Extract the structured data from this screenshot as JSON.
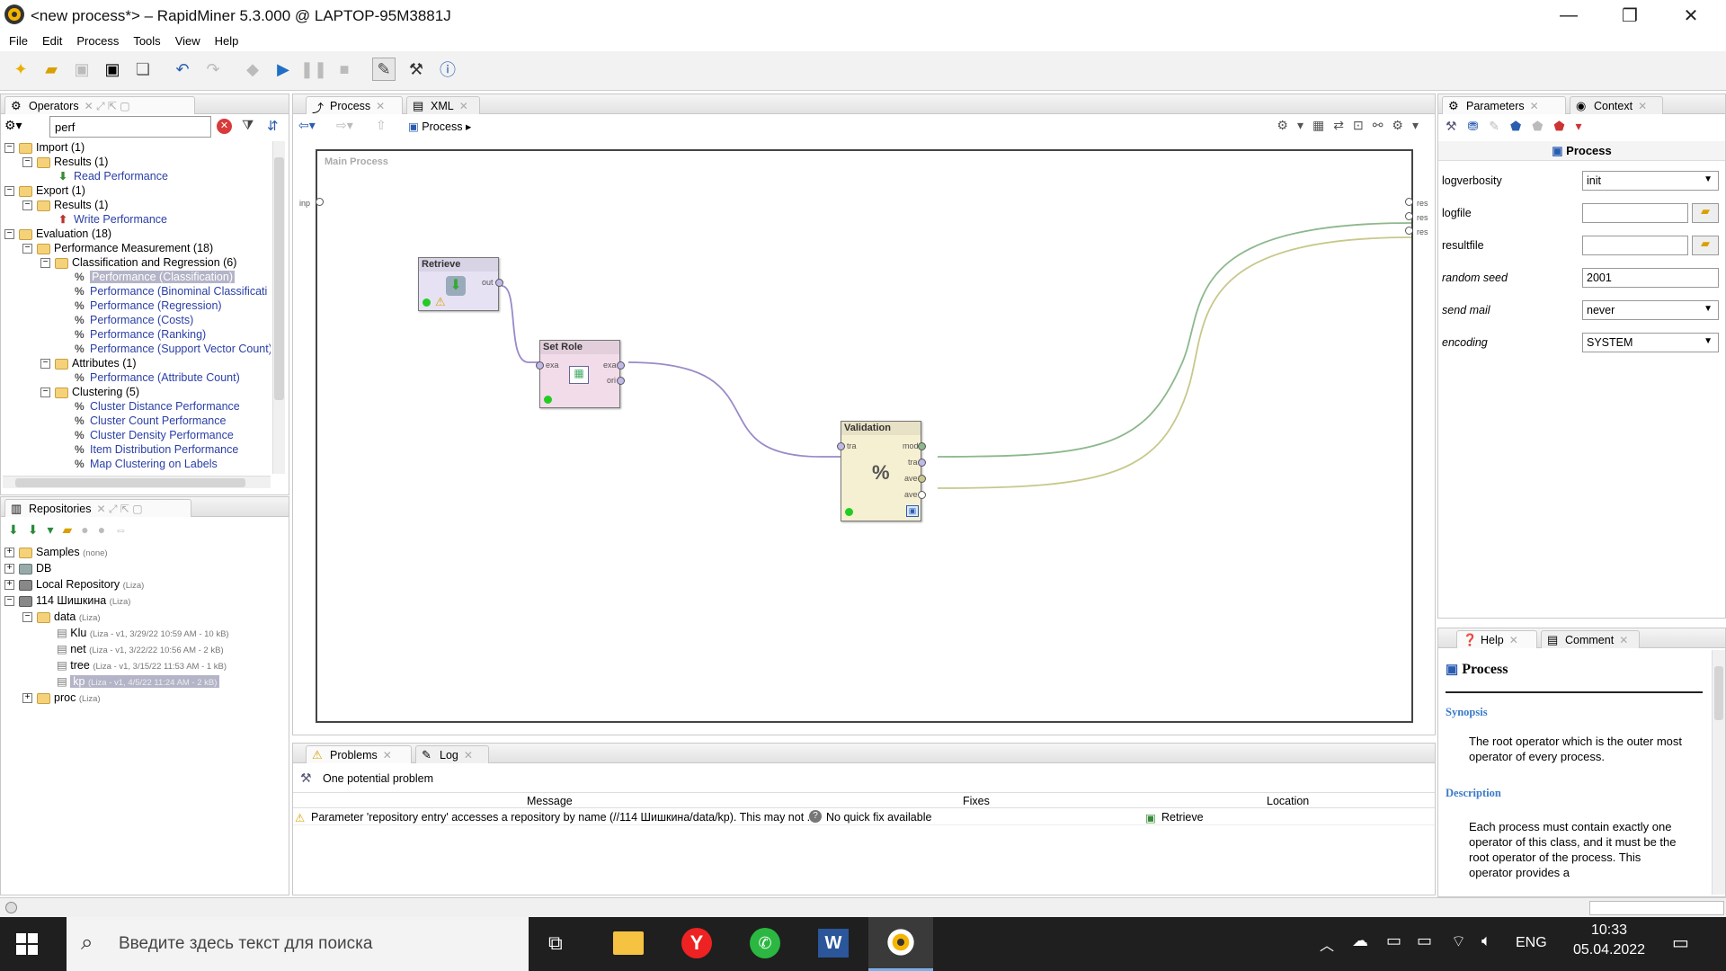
{
  "window": {
    "title": "<new process*> – RapidMiner 5.3.000 @ LAPTOP-95M3881J"
  },
  "menu": [
    "File",
    "Edit",
    "Process",
    "Tools",
    "View",
    "Help"
  ],
  "operators_panel": {
    "tab": "Operators",
    "search_value": "perf",
    "tree": [
      {
        "label": "Import (1)"
      },
      {
        "label": "Results (1)"
      },
      {
        "label": "Read Performance"
      },
      {
        "label": "Export (1)"
      },
      {
        "label": "Results (1)"
      },
      {
        "label": "Write Performance"
      },
      {
        "label": "Evaluation (18)"
      },
      {
        "label": "Performance Measurement (18)"
      },
      {
        "label": "Classification and Regression (6)"
      },
      {
        "label": "Performance (Classification)"
      },
      {
        "label": "Performance (Binominal Classificati"
      },
      {
        "label": "Performance (Regression)"
      },
      {
        "label": "Performance (Costs)"
      },
      {
        "label": "Performance (Ranking)"
      },
      {
        "label": "Performance (Support Vector Count)"
      },
      {
        "label": "Attributes (1)"
      },
      {
        "label": "Performance (Attribute Count)"
      },
      {
        "label": "Clustering (5)"
      },
      {
        "label": "Cluster Distance Performance"
      },
      {
        "label": "Cluster Count Performance"
      },
      {
        "label": "Cluster Density Performance"
      },
      {
        "label": "Item Distribution Performance"
      },
      {
        "label": "Map Clustering on Labels"
      }
    ]
  },
  "repositories_panel": {
    "tab": "Repositories",
    "tree": [
      {
        "label": "Samples",
        "meta": "(none)"
      },
      {
        "label": "DB",
        "meta": ""
      },
      {
        "label": "Local Repository",
        "meta": "(Liza)"
      },
      {
        "label": "114 Шишкина",
        "meta": "(Liza)"
      },
      {
        "label": "data",
        "meta": "(Liza)"
      },
      {
        "label": "Klu",
        "meta": "(Liza - v1, 3/29/22 10:59 AM - 10 kB)"
      },
      {
        "label": "net",
        "meta": "(Liza - v1, 3/22/22 10:56 AM - 2 kB)"
      },
      {
        "label": "tree",
        "meta": "(Liza - v1, 3/15/22 11:53 AM - 1 kB)"
      },
      {
        "label": "kp",
        "meta": "(Liza - v1, 4/5/22 11:24 AM - 2 kB)"
      },
      {
        "label": "proc",
        "meta": "(Liza)"
      }
    ]
  },
  "process_panel": {
    "tabs": [
      "Process",
      "XML"
    ],
    "breadcrumb": "Process",
    "canvas_label": "Main Process",
    "input_port": "inp",
    "result_ports": [
      "res",
      "res",
      "res"
    ],
    "operators": [
      {
        "name": "Retrieve",
        "ports_out": [
          "out"
        ]
      },
      {
        "name": "Set Role",
        "ports_in": [
          "exa"
        ],
        "ports_out": [
          "exa",
          "ori"
        ]
      },
      {
        "name": "Validation",
        "ports_in": [
          "tra"
        ],
        "ports_out": [
          "mod",
          "tra",
          "ave",
          "ave"
        ]
      }
    ]
  },
  "problems_panel": {
    "tabs": [
      "Problems",
      "Log"
    ],
    "summary": "One potential problem",
    "columns": [
      "Message",
      "Fixes",
      "Location"
    ],
    "rows": [
      {
        "message": "Parameter 'repository entry' accesses a repository by name (//114 Шишкина/data/kp). This may not ...",
        "fix": "No quick fix available",
        "location": "Retrieve"
      }
    ]
  },
  "parameters_panel": {
    "tabs": [
      "Parameters",
      "Context"
    ],
    "operator": "Process",
    "params": [
      {
        "label": "logverbosity",
        "value": "init",
        "type": "select"
      },
      {
        "label": "logfile",
        "value": "",
        "type": "file"
      },
      {
        "label": "resultfile",
        "value": "",
        "type": "file"
      },
      {
        "label": "random seed",
        "value": "2001",
        "type": "text"
      },
      {
        "label": "send mail",
        "value": "never",
        "type": "select"
      },
      {
        "label": "encoding",
        "value": "SYSTEM",
        "type": "select"
      }
    ]
  },
  "help_panel": {
    "tabs": [
      "Help",
      "Comment"
    ],
    "title": "Process",
    "synopsis_heading": "Synopsis",
    "synopsis": "The root operator which is the outer most operator of every process.",
    "description_heading": "Description",
    "description": "Each process must contain exactly one operator of this class, and it must be the root operator of the process. This operator provides a"
  },
  "taskbar": {
    "search_placeholder": "Введите здесь текст для поиска",
    "lang": "ENG",
    "time": "10:33",
    "date": "05.04.2022"
  }
}
